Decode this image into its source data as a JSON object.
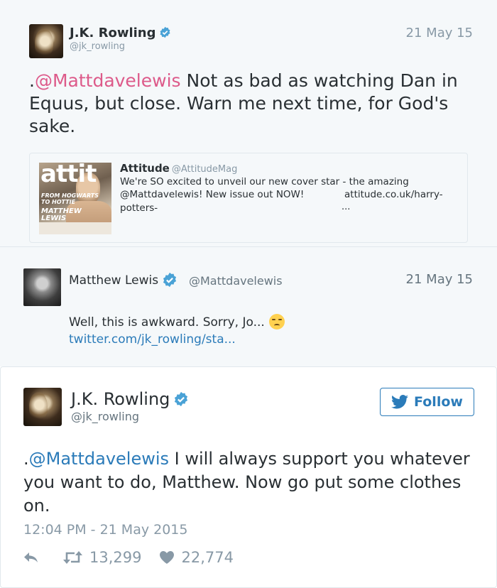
{
  "tweet1": {
    "name": "J.K. Rowling",
    "handle": "@jk_rowling",
    "date": "21 May 15",
    "text_prefix": ".",
    "mention": "@Mattdavelewis",
    "text_rest": " Not as bad as watching Dan in Equus, but close. Warn me next time, for God's sake.",
    "quote": {
      "name": "Attitude",
      "handle": "@AttitudeMag",
      "line1": "We're SO excited to unveil our new cover star - the amazing",
      "line2": "@Mattdavelewis! New issue out NOW!",
      "link": "attitude.co.uk/harry-",
      "line3": "potters-",
      "ellipsis": "...",
      "image": {
        "masthead": "attit",
        "cover_text1": "FROM HOGWARTS",
        "cover_text2": "TO HOTTIE",
        "cover_text3": "MATTHEW",
        "cover_text4": "LEWIS"
      }
    }
  },
  "tweet2": {
    "name": "Matthew Lewis",
    "handle": "@Mattdavelewis",
    "date": "21 May 15",
    "text": "Well, this is awkward. Sorry, Jo...",
    "emoji": "pensive-face",
    "link": "twitter.com/jk_rowling/sta..."
  },
  "tweet3": {
    "name": "J.K. Rowling",
    "handle": "@jk_rowling",
    "follow_label": "Follow",
    "text_prefix": ".",
    "mention": "@Mattdavelewis",
    "text_rest": " I will always support you whatever you want to do, Matthew. Now go put some clothes on.",
    "timestamp": "12:04 PM - 21 May 2015",
    "retweets": "13,299",
    "likes": "22,774"
  },
  "colors": {
    "link_blue": "#2b7bb9",
    "mention_pink": "#dd5a8a",
    "verified_blue": "#4aa2d6",
    "muted": "#8899a6",
    "card_bg": "#f5f8fa"
  }
}
